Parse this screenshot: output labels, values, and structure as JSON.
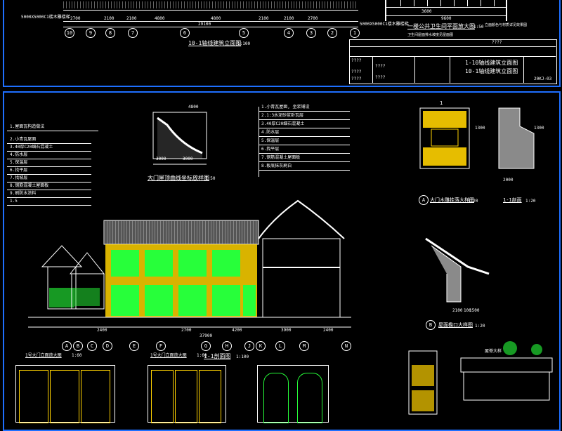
{
  "top_sheet": {
    "dims_top": [
      "2700",
      "2100",
      "2100",
      "4800",
      "4800",
      "2100",
      "2100",
      "2700"
    ],
    "dim_total": "29100",
    "grid_axes": [
      "10",
      "9",
      "8",
      "7",
      "6",
      "5",
      "4",
      "3",
      "2",
      "1"
    ],
    "elevation_title": "10-1轴线建筑立面图",
    "elevation_scale": "1:100",
    "left_note": "5000X5000C1楼木雕楼梯",
    "right_note": "5000X5000C1楼木雕楼梯",
    "detail_title": "一楼公共卫生间平面放大图",
    "detail_scale": "1:50",
    "dim_3600": "3600",
    "dim_9600": "9600",
    "note_toilet": "卫生间屋面排水坡度见屋面图",
    "note_right": "立面颜色与材质详见效果图",
    "title_block": {
      "row1": "????",
      "drawing_name_1": "1-10轴线建筑立面图",
      "drawing_name_2": "10-1轴线建筑立面图",
      "sheet_no": "20KJ-03",
      "cells": [
        "????",
        "????",
        "????",
        "????",
        "????"
      ]
    }
  },
  "bottom_sheet": {
    "notes_title": "1.屋面瓦构造做法",
    "notes": [
      "2.小青瓦屋面",
      "3.40厚C20细石混凝土",
      "4.防水层",
      "5.保温层",
      "6.找平层",
      "7.找坡层",
      "8.钢筋混凝土屋面板",
      "9.刷防水涂料",
      "1.5"
    ],
    "curve_title": "大门屋顶曲线坐标放样图",
    "curve_scale": "1:50",
    "curve_dims": [
      "4800",
      "3000",
      "3000"
    ],
    "roof_notes": [
      "1.小青瓦屋面, 坐浆铺设",
      "2.1:3水泥砂浆卧瓦层",
      "3.40厚C20细石混凝土",
      "4.防水层",
      "5.保温层",
      "6.找平层",
      "7.钢筋混凝土屋面板",
      "8.板底抹灰刷白"
    ],
    "section_dims": [
      "2400",
      "2700",
      "4200",
      "3900",
      "2400"
    ],
    "section_total": "37900",
    "grid_letters": [
      "A",
      "B",
      "C",
      "D",
      "E",
      "F",
      "G",
      "H",
      "J",
      "K",
      "L",
      "M",
      "N"
    ],
    "door_1_title": "1号大门立面放大图",
    "door_1_scale": "1:60",
    "door_2_title": "1号大门立面放大图",
    "door_2_scale": "1:60",
    "section_title": "1-1剖面图",
    "section_scale": "1:100",
    "detail_1_title": "大门木雕挂落大样图",
    "detail_1_scale": "1:20",
    "detail_2_title": "屋面檐口大样图",
    "detail_2_scale": "1:20",
    "detail_3_title": "1-1剖面",
    "detail_3_scale": "1:20",
    "eave_label": "屋脊大样",
    "dim_1300": "1300",
    "dim_2000": "2000",
    "dim_2100": "2100",
    "dim_1500": "1500",
    "dim_100": "100",
    "label_a": "A",
    "label_b": "B",
    "label_1": "1"
  },
  "colors": {
    "sheet_border": "#1e6fff",
    "building_yellow": "#ffd200",
    "building_green": "#27ff3a",
    "line_white": "#ffffff",
    "roof_grey": "#9a9a9a"
  }
}
